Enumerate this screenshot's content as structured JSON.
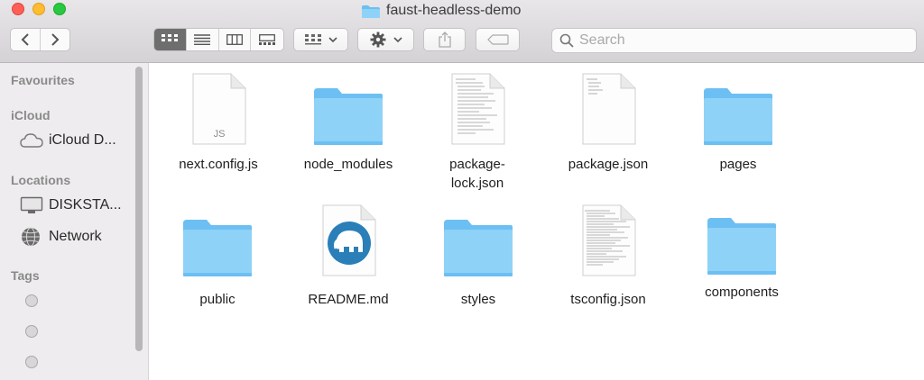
{
  "window": {
    "title": "faust-headless-demo"
  },
  "toolbar": {
    "search_placeholder": "Search"
  },
  "sidebar": {
    "favourites_header": "Favourites",
    "icloud_header": "iCloud",
    "icloud_item": "iCloud D...",
    "locations_header": "Locations",
    "location_items": [
      "DISKSTA...",
      "Network"
    ],
    "tags_header": "Tags"
  },
  "files": [
    {
      "name": "next.config.js",
      "kind": "js",
      "badge": "JS"
    },
    {
      "name": "node_modules",
      "kind": "folder"
    },
    {
      "name": "package-\nlock.json",
      "kind": "text-doc"
    },
    {
      "name": "package.json",
      "kind": "doc-small"
    },
    {
      "name": "pages",
      "kind": "folder"
    },
    {
      "name": "public",
      "kind": "folder"
    },
    {
      "name": "README.md",
      "kind": "mamp"
    },
    {
      "name": "styles",
      "kind": "folder"
    },
    {
      "name": "tsconfig.json",
      "kind": "text-doc"
    },
    {
      "name": "components",
      "kind": "folder"
    }
  ],
  "colors": {
    "folder_body": "#7cc8f5",
    "folder_tab": "#8fd2f7",
    "mamp_blue": "#2a7fb8",
    "traffic_red": "#fd5f57",
    "traffic_yellow": "#febc2e",
    "traffic_green": "#28c840"
  }
}
